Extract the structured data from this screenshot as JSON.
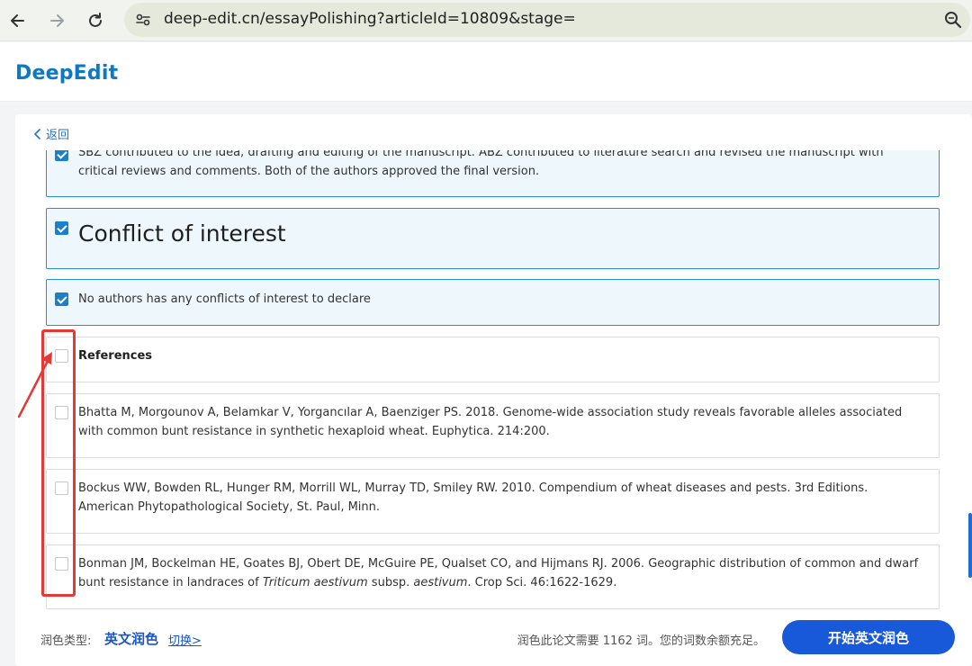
{
  "browser": {
    "url": "deep-edit.cn/essayPolishing?articleId=10809&stage="
  },
  "app": {
    "logo": "DeepEdit",
    "back_label": "返回"
  },
  "paragraphs": [
    {
      "text": "SBZ contributed to the idea, drafting and editing of the manuscript. ABZ contributed to literature search and revised the manuscript with critical reviews and comments. Both of the authors approved the final version.",
      "checked": true
    },
    {
      "text": "Conflict of interest",
      "checked": true,
      "style": "heading"
    },
    {
      "text": "No authors has any conflicts of interest to declare",
      "checked": true
    },
    {
      "text": "References",
      "checked": false,
      "style": "bold"
    },
    {
      "text": "Bhatta M, Morgounov A, Belamkar V, Yorgancılar A, Baenziger PS. 2018. Genome-wide association study reveals favorable alleles associated with common bunt resistance in synthetic hexaploid wheat. Euphytica. 214:200.",
      "checked": false
    },
    {
      "text": "Bockus WW, Bowden RL, Hunger RM, Morrill WL, Murray TD, Smiley RW. 2010. Compendium of wheat diseases and pests. 3rd Editions. American Phytopathological Society, St. Paul, Minn.",
      "checked": false
    },
    {
      "text_parts": {
        "a": "Bonman JM, Bockelman HE, Goates BJ, Obert DE, McGuire PE, Qualset CO, and Hijmans RJ. 2006. Geographic distribution of common and dwarf bunt resistance in landraces of ",
        "b": "Triticum aestivum",
        "c": " subsp. ",
        "d": "aestivum",
        "e": ". Crop Sci. 46:1622-1629."
      },
      "checked": false
    }
  ],
  "footer": {
    "polish_type_label": "润色类型:",
    "polish_type_value": "英文润色",
    "switch_label": "切换>",
    "word_info": "润色此论文需要 1162 词。您的词数余额充足。",
    "start_button": "开始英文润色"
  },
  "colors": {
    "brand": "#0e78c5",
    "primary_button": "#1759d9",
    "checked_bg": "#eef7fc",
    "annotation": "#e53935"
  }
}
